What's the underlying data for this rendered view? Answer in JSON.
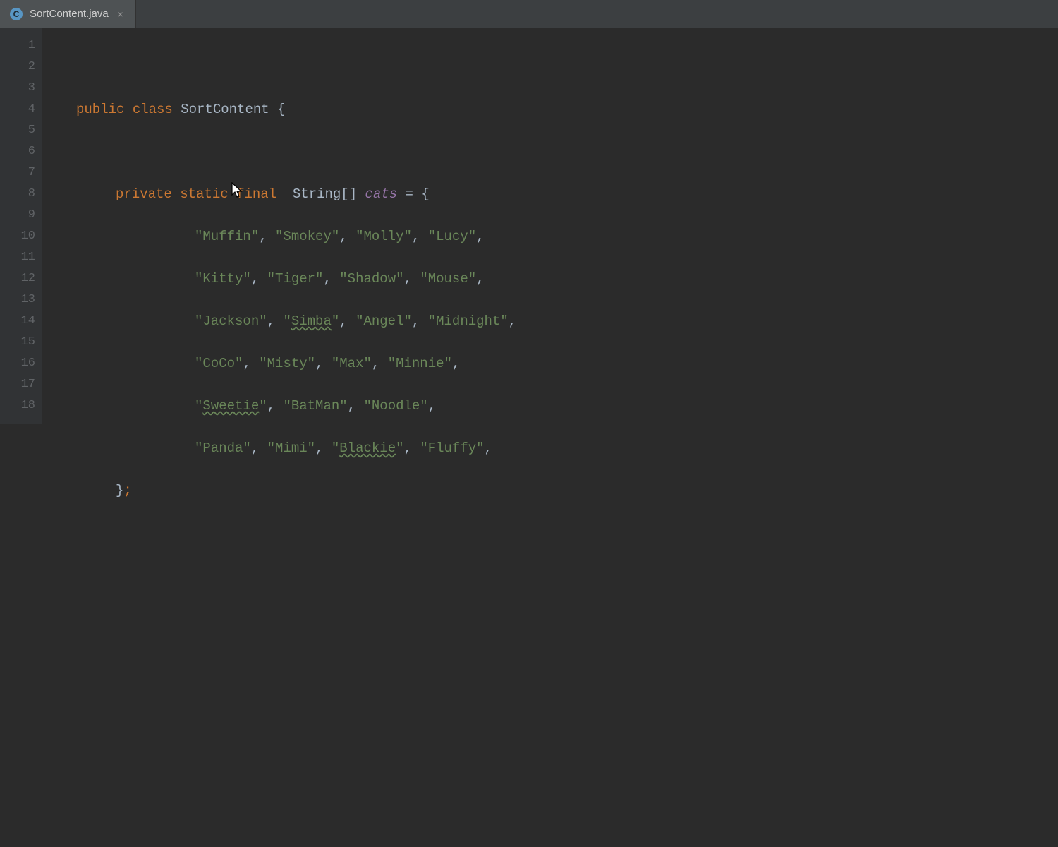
{
  "tab": {
    "icon_letter": "C",
    "filename": "SortContent.java",
    "close_glyph": "×"
  },
  "gutter": {
    "lines": [
      "1",
      "2",
      "3",
      "4",
      "5",
      "6",
      "7",
      "8",
      "9",
      "10",
      "11",
      "12",
      "13",
      "14",
      "15",
      "16",
      "17",
      "18"
    ]
  },
  "code": {
    "l2": {
      "kw1": "public",
      "kw2": "class",
      "name": "SortContent",
      "brace": "{"
    },
    "l4": {
      "kw1": "private",
      "kw2": "static",
      "kw3": "final",
      "type": "String[]",
      "field": "cats",
      "eq": "=",
      "brace": "{"
    },
    "l5": {
      "v1": "\"Muffin\"",
      "v2": "\"Smokey\"",
      "v3": "\"Molly\"",
      "v4": "\"Lucy\""
    },
    "l6": {
      "v1": "\"Kitty\"",
      "v2": "\"Tiger\"",
      "v3": "\"Shadow\"",
      "v4": "\"Mouse\""
    },
    "l7": {
      "v1": "\"Jackson\"",
      "v2a": "\"",
      "v2b": "Simba",
      "v2c": "\"",
      "v3": "\"Angel\"",
      "v4": "\"Midnight\""
    },
    "l8": {
      "v1": "\"CoCo\"",
      "v2": "\"Misty\"",
      "v3": "\"Max\"",
      "v4": "\"Minnie\""
    },
    "l9": {
      "v1a": "\"",
      "v1b": "Sweetie",
      "v1c": "\"",
      "v2": "\"BatMan\"",
      "v3": "\"Noodle\""
    },
    "l10": {
      "v1": "\"Panda\"",
      "v2": "\"Mimi\"",
      "v3a": "\"",
      "v3b": "Blackie",
      "v3c": "\"",
      "v4": "\"Fluffy\""
    },
    "l11": {
      "brace": "}",
      "semi": ";"
    }
  }
}
